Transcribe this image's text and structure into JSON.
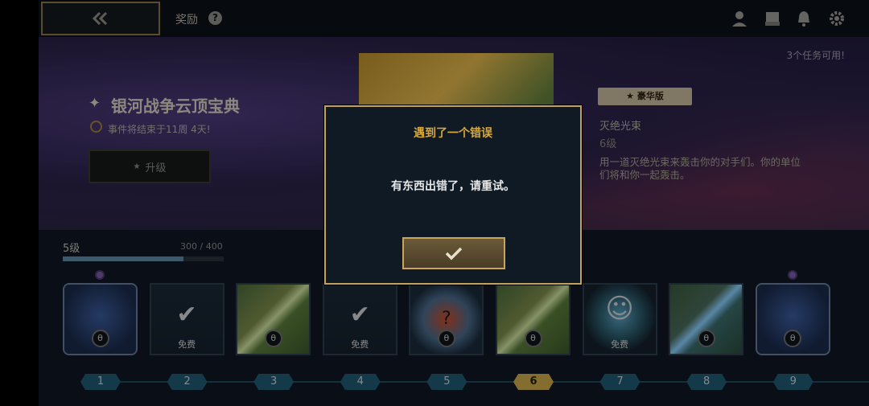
{
  "topbar": {
    "title": "奖励",
    "help": "?"
  },
  "hero": {
    "tasks_available": "3个任务可用!",
    "event_title": "银河战争云顶宝典",
    "event_subtitle": "事件将结束于11周 4天!",
    "upgrade_label": "升级",
    "badge_label": "豪华版",
    "reward_name": "灭绝光束",
    "reward_level": "6级",
    "reward_desc": "用一道灭绝光束来轰击你的对手们。你的单位们将和你一起轰击。"
  },
  "progress": {
    "level_label": "5级",
    "xp_text": "300 / 400",
    "xp_fraction": 0.75
  },
  "track": {
    "cards": [
      {
        "number": "1",
        "kind": "special",
        "locked": true,
        "free": false
      },
      {
        "number": "2",
        "kind": "check",
        "locked": false,
        "free": true
      },
      {
        "number": "3",
        "kind": "beam",
        "locked": true,
        "free": false
      },
      {
        "number": "4",
        "kind": "check",
        "locked": false,
        "free": true
      },
      {
        "number": "5",
        "kind": "egg",
        "locked": true,
        "free": false
      },
      {
        "number": "6",
        "kind": "beam",
        "locked": true,
        "free": false,
        "current": true
      },
      {
        "number": "7",
        "kind": "emote",
        "locked": false,
        "free": true
      },
      {
        "number": "8",
        "kind": "beam-blue",
        "locked": true,
        "free": false
      },
      {
        "number": "9",
        "kind": "special",
        "locked": true,
        "free": false
      }
    ],
    "free_label": "免费",
    "lock_glyph": "θ"
  },
  "modal": {
    "title": "遇到了一个错误",
    "message": "有东西出错了，请重试。"
  },
  "colors": {
    "gold": "#c2a25a",
    "current_level": "#c9a94a",
    "level_chip": "#1f5a72"
  }
}
